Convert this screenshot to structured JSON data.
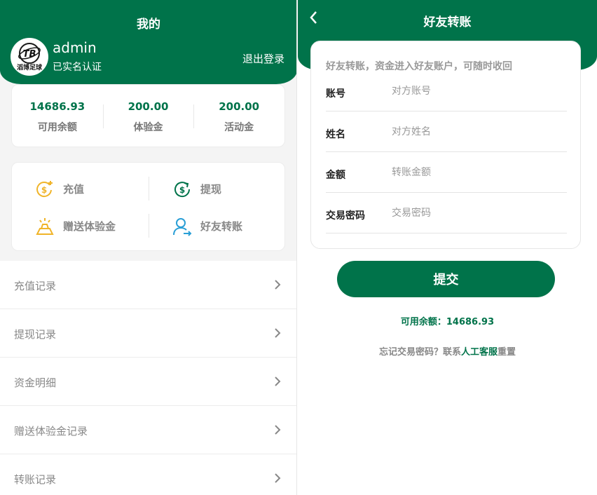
{
  "profile": {
    "title": "我的",
    "username": "admin",
    "verified": "已实名认证",
    "logout": "退出登录",
    "logo_text": "TB",
    "logo_sub": "滔博足球",
    "balances": [
      {
        "value": "14686.93",
        "label": "可用余额"
      },
      {
        "value": "200.00",
        "label": "体验金"
      },
      {
        "value": "200.00",
        "label": "活动金"
      }
    ],
    "actions": [
      {
        "label": "充值"
      },
      {
        "label": "提现"
      },
      {
        "label": "赠送体验金"
      },
      {
        "label": "好友转账"
      }
    ],
    "menu": [
      {
        "label": "充值记录"
      },
      {
        "label": "提现记录"
      },
      {
        "label": "资金明细"
      },
      {
        "label": "赠送体验金记录"
      },
      {
        "label": "转账记录"
      }
    ]
  },
  "transfer": {
    "title": "好友转账",
    "hint": "好友转账，资金进入好友账户，可随时收回",
    "fields": [
      {
        "label": "账号",
        "placeholder": "对方账号"
      },
      {
        "label": "姓名",
        "placeholder": "对方姓名"
      },
      {
        "label": "金额",
        "placeholder": "转账金额"
      },
      {
        "label": "交易密码",
        "placeholder": "交易密码"
      }
    ],
    "submit": "提交",
    "available": "可用余额：14686.93",
    "forgot_prefix": "忘记交易密码？联系",
    "forgot_link": "人工客服",
    "forgot_suffix": "重置"
  },
  "colors": {
    "brand": "#00734a",
    "coin_yellow": "#f0b429",
    "withdraw_green": "#00734a",
    "friend_blue": "#2a9fd6"
  },
  "icons": {
    "recharge": "coin-plus-icon",
    "withdraw": "coin-cycle-icon",
    "gift": "gold-bar-icon",
    "friend": "user-transfer-icon",
    "chevron": "chevron-right-icon",
    "back": "chevron-left-icon"
  }
}
